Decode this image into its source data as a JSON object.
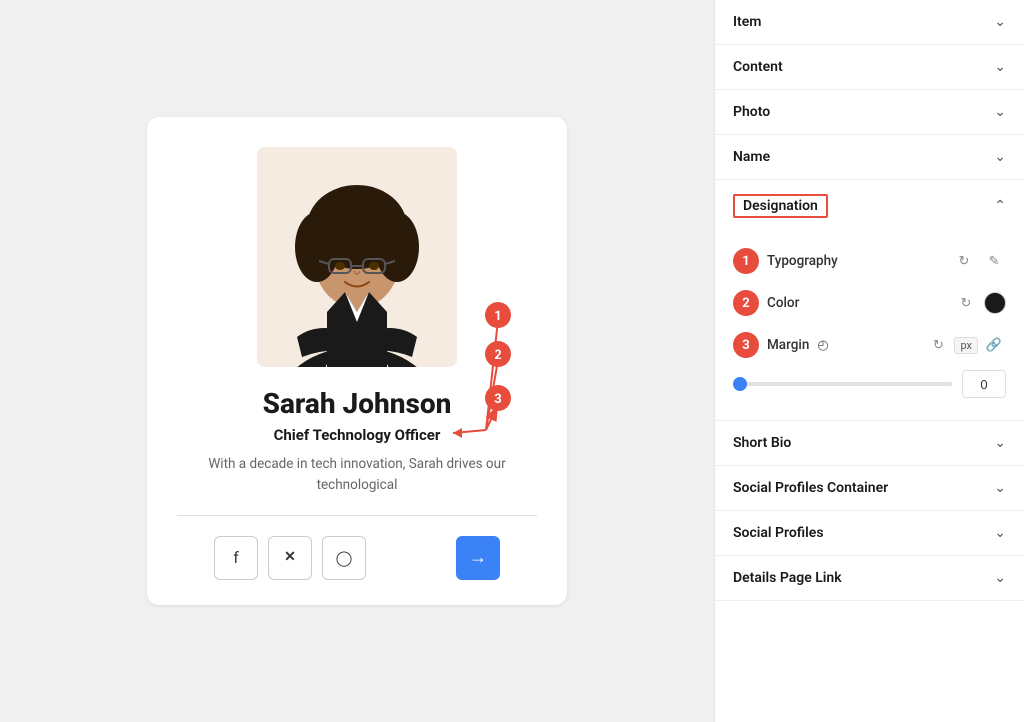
{
  "card": {
    "person_name": "Sarah Johnson",
    "person_title": "Chief Technology Officer",
    "person_bio": "With a decade in tech innovation, Sarah drives our technological",
    "social": {
      "facebook_label": "f",
      "twitter_label": "𝕏",
      "instagram_label": "Instagram",
      "arrow_label": "→"
    }
  },
  "right_panel": {
    "sections": [
      {
        "id": "item",
        "label": "Item",
        "state": "collapsed"
      },
      {
        "id": "content",
        "label": "Content",
        "state": "collapsed"
      },
      {
        "id": "photo",
        "label": "Photo",
        "state": "collapsed"
      },
      {
        "id": "name",
        "label": "Name",
        "state": "collapsed"
      },
      {
        "id": "designation",
        "label": "Designation",
        "state": "expanded"
      },
      {
        "id": "short-bio",
        "label": "Short Bio",
        "state": "collapsed"
      },
      {
        "id": "social-profiles-container",
        "label": "Social Profiles Container",
        "state": "collapsed"
      },
      {
        "id": "social-profiles",
        "label": "Social Profiles",
        "state": "collapsed"
      },
      {
        "id": "details-page-link",
        "label": "Details Page Link",
        "state": "collapsed"
      }
    ],
    "designation_settings": {
      "typography_label": "Typography",
      "color_label": "Color",
      "margin_label": "Margin",
      "margin_value": "0",
      "margin_unit": "px",
      "slider_value": 0
    }
  },
  "badges": {
    "badge_1": "1",
    "badge_2": "2",
    "badge_3": "3"
  }
}
